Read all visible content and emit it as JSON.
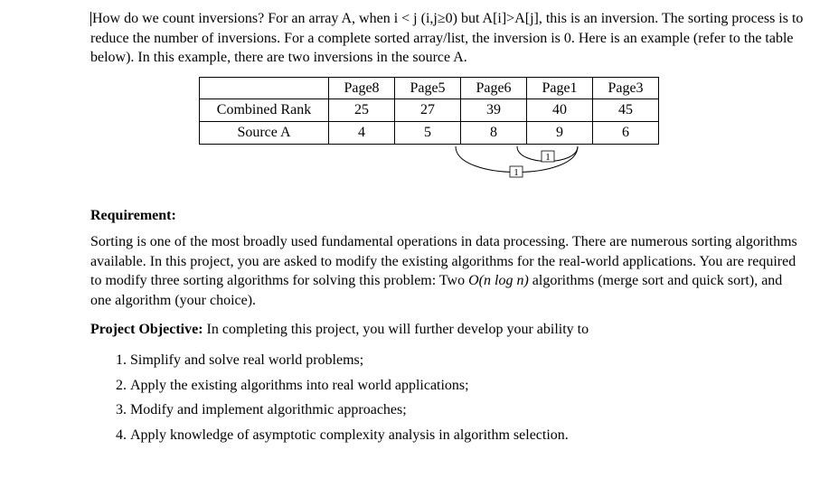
{
  "intro": {
    "p1": "How do we count inversions? For an array A, when i < j (i,j≥0) but A[i]>A[j], this is an inversion. The sorting process is to reduce the number of inversions. For a complete sorted array/list, the inversion is 0. Here is an example (refer to the table below). In this example, there are two inversions in the source A."
  },
  "table": {
    "col_headers": [
      "Page8",
      "Page5",
      "Page6",
      "Page1",
      "Page3"
    ],
    "rows": [
      {
        "label": "Combined Rank",
        "cells": [
          "25",
          "27",
          "39",
          "40",
          "45"
        ]
      },
      {
        "label": "Source A",
        "cells": [
          "4",
          "5",
          "8",
          "9",
          "6"
        ]
      }
    ],
    "arc_labels": [
      "1",
      "1"
    ]
  },
  "requirement": {
    "heading": "Requirement:",
    "body_prefix": "Sorting is one of the most broadly used fundamental operations in data processing. There are numerous sorting algorithms available. In this project, you are asked to modify the existing algorithms for the real-world applications. You are required to modify three sorting algorithms for solving this problem: Two ",
    "body_bigO": "O(n log n)",
    "body_suffix": " algorithms (merge sort and quick sort), and one algorithm (your choice)."
  },
  "objective": {
    "lead_bold": "Project Objective: ",
    "lead_rest": "In completing this project, you will further develop your ability to",
    "items": [
      "Simplify and solve real world problems;",
      "Apply the existing algorithms into real world applications;",
      "Modify and implement algorithmic approaches;",
      "Apply knowledge of asymptotic complexity analysis in algorithm selection."
    ]
  }
}
